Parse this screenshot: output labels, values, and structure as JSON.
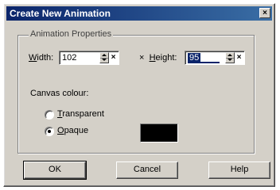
{
  "window": {
    "title": "Create New Animation",
    "close_glyph": "×"
  },
  "group": {
    "legend": "Animation Properties"
  },
  "width": {
    "label_mnemonic": "W",
    "label_rest": "idth:",
    "value": "102",
    "clear_glyph": "×"
  },
  "height": {
    "prefix": "×",
    "label_mnemonic": "H",
    "label_rest": "eight:",
    "value": "95",
    "clear_glyph": "×"
  },
  "canvas": {
    "label": "Canvas colour:",
    "options": [
      {
        "mnemonic": "T",
        "rest": "ransparent",
        "selected": false
      },
      {
        "mnemonic": "O",
        "rest": "paque",
        "selected": true
      }
    ],
    "swatch_color": "#000000"
  },
  "buttons": {
    "ok": "OK",
    "cancel": "Cancel",
    "help": "Help"
  },
  "colors": {
    "titlebar_start": "#0a246a",
    "titlebar_end": "#3a6ea5",
    "dialog_face": "#d4d0c8",
    "selection": "#0a246a"
  },
  "icons": {
    "close": "close-icon",
    "spin_up": "spin-up-icon",
    "spin_down": "spin-down-icon",
    "clear": "clear-icon"
  }
}
